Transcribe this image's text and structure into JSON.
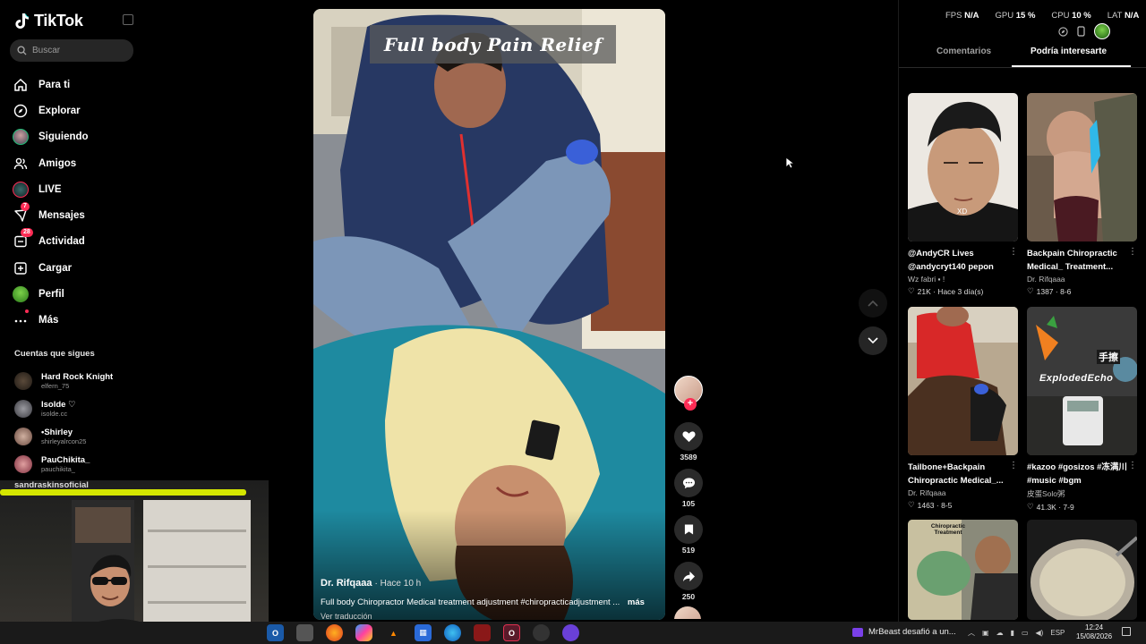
{
  "app": {
    "name": "TikTok"
  },
  "search": {
    "placeholder": "Buscar"
  },
  "nav": {
    "items": [
      {
        "label": "Para ti",
        "icon": "home-icon"
      },
      {
        "label": "Explorar",
        "icon": "compass-icon"
      },
      {
        "label": "Siguiendo",
        "icon": "following-avatar-icon"
      },
      {
        "label": "Amigos",
        "icon": "friends-icon"
      },
      {
        "label": "LIVE",
        "icon": "live-icon"
      },
      {
        "label": "Mensajes",
        "icon": "messages-icon",
        "badge": "7"
      },
      {
        "label": "Actividad",
        "icon": "activity-icon",
        "badge": "28"
      },
      {
        "label": "Cargar",
        "icon": "upload-icon"
      },
      {
        "label": "Perfil",
        "icon": "profile-avatar-icon"
      },
      {
        "label": "Más",
        "icon": "more-icon"
      }
    ]
  },
  "following": {
    "title": "Cuentas que sigues",
    "accounts": [
      {
        "name": "Hard Rock Knight",
        "user": "elfern_75"
      },
      {
        "name": "Isolde ♡",
        "user": "isolde.cc"
      },
      {
        "name": "•Shirley",
        "user": "shirleyalrcon25"
      },
      {
        "name": "PauChikita_",
        "user": "pauchikita_"
      }
    ],
    "partial_account": "sandraskinsoficial"
  },
  "video": {
    "overlay_title": "Full body Pain Relief",
    "author": "Dr. Rifqaaa",
    "time": "Hace 10 h",
    "description": "Full body Chiropractor Medical treatment adjustment #chiropracticadjustment ...",
    "more_label": "más",
    "translate_label": "Ver traducción"
  },
  "actions": {
    "likes": "3589",
    "comments": "105",
    "saves": "519",
    "shares": "250"
  },
  "stats": {
    "fps_label": "FPS",
    "fps_value": "N/A",
    "gpu_label": "GPU",
    "gpu_value": "15 %",
    "cpu_label": "CPU",
    "cpu_value": "10 %",
    "lat_label": "LAT",
    "lat_value": "N/A"
  },
  "tabs": {
    "comments": "Comentarios",
    "recommended": "Podría interesarte"
  },
  "recommendations": [
    {
      "title": "@AndyCR Lives @andycryt140 pepon",
      "author": "Wz fabri ▪ !",
      "meta": "21K · Hace 3 día(s)",
      "thumb_text": "XD"
    },
    {
      "title": "Backpain Chiropractic Medical_ Treatment...",
      "author": "Dr. Rifqaaa",
      "meta": "1387 · 8-6",
      "thumb_text": ""
    },
    {
      "title": "Tailbone+Backpain Chiropractic Medical_...",
      "author": "Dr. Rifqaaa",
      "meta": "1463 · 8-5",
      "thumb_text": ""
    },
    {
      "title": "#kazoo #gosizos #冻满川 #music #bgm",
      "author": "皮蛋Solo粥",
      "meta": "41.3K · 7-9",
      "thumb_text": "ExplodedEcho",
      "thumb_text2": "手擦"
    },
    {
      "title": "",
      "author": "",
      "meta": "",
      "thumb_text": "Chiropractic Treatment"
    },
    {
      "title": "",
      "author": "",
      "meta": "",
      "thumb_text": ""
    }
  ],
  "taskbar": {
    "notification": "MrBeast desafió a un...",
    "lang": "ESP",
    "time": "12:24",
    "date": "15/08/2026"
  },
  "colors": {
    "accent": "#fe2c55",
    "background": "#000000",
    "webcam_strip": "#d4e600"
  }
}
